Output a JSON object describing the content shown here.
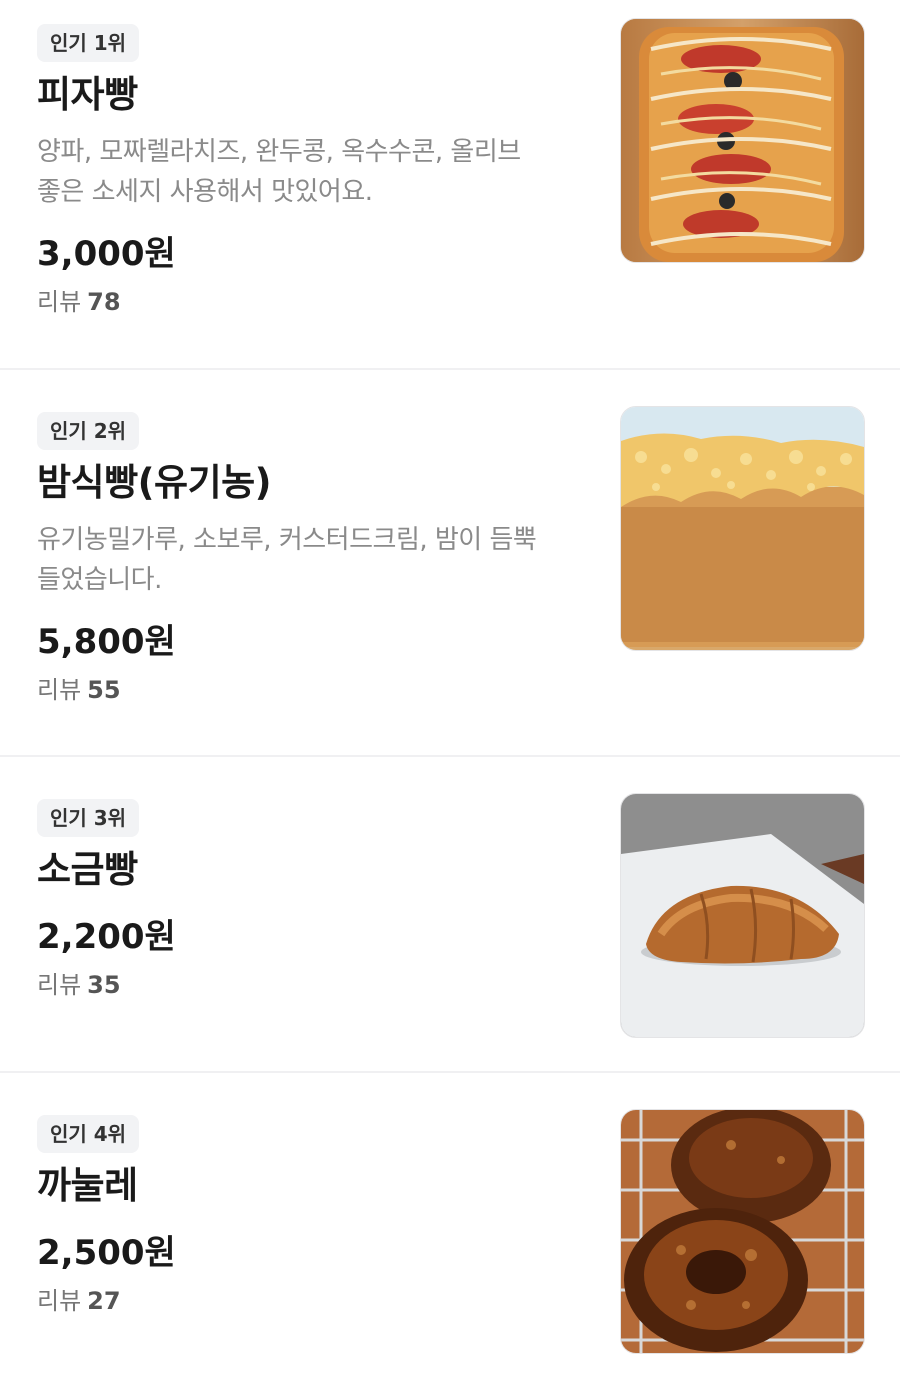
{
  "menu": {
    "items": [
      {
        "rank_badge": "인기 1위",
        "name": "피자빵",
        "description_lines": [
          "양파, 모짜렐라치즈, 완두콩, 옥수수콘, 올리브",
          "좋은 소세지 사용해서 맛있어요."
        ],
        "price": "3,000원",
        "review_label": "리뷰",
        "review_count": "78",
        "image_icon": "pizza-bread-photo"
      },
      {
        "rank_badge": "인기 2위",
        "name": "밤식빵(유기농)",
        "description_lines": [
          "유기농밀가루, 소보루, 커스터드크림, 밤이 듬뿍",
          "들었습니다."
        ],
        "price": "5,800원",
        "review_label": "리뷰",
        "review_count": "55",
        "image_icon": "chestnut-bread-photo"
      },
      {
        "rank_badge": "인기 3위",
        "name": "소금빵",
        "description_lines": [],
        "price": "2,200원",
        "review_label": "리뷰",
        "review_count": "35",
        "image_icon": "salt-bread-photo"
      },
      {
        "rank_badge": "인기 4위",
        "name": "까눌레",
        "description_lines": [],
        "price": "2,500원",
        "review_label": "리뷰",
        "review_count": "27",
        "image_icon": "canele-photo"
      }
    ]
  },
  "colors": {
    "background": "#ffffff",
    "badge_bg": "#f2f3f5",
    "description_text": "#8a8a8a",
    "divider": "#f0f0f2"
  }
}
